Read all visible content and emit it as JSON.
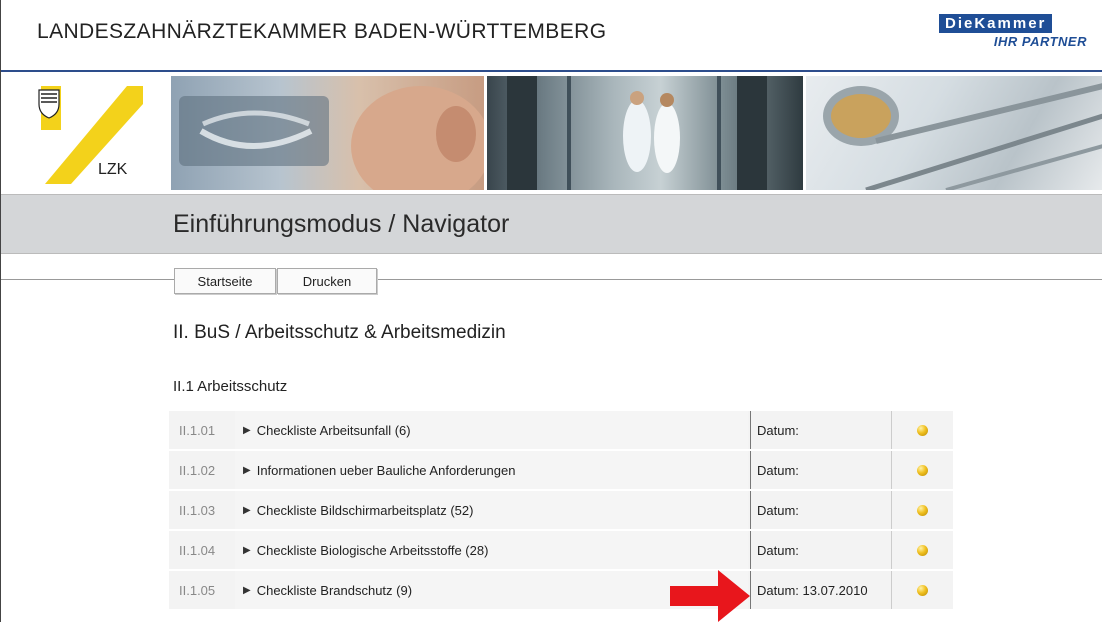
{
  "header": {
    "org_name": "LANDESZAHNÄRZTEKAMMER BADEN-WÜRTTEMBERG",
    "brand_top": "DieKammer",
    "brand_sub": "IHR PARTNER",
    "logo_text": "LZK"
  },
  "page": {
    "title": "Einführungsmodus / Navigator"
  },
  "nav": {
    "start_label": "Startseite",
    "print_label": "Drucken"
  },
  "content": {
    "section_heading": "II. BuS / Arbeitsschutz & Arbeitsmedizin",
    "sub_heading": "II.1 Arbeitsschutz",
    "rows": [
      {
        "code": "II.1.01",
        "title": "Checkliste Arbeitsunfall (6)",
        "date": "Datum:"
      },
      {
        "code": "II.1.02",
        "title": "Informationen ueber Bauliche Anforderungen",
        "date": "Datum:"
      },
      {
        "code": "II.1.03",
        "title": "Checkliste Bildschirmarbeitsplatz (52)",
        "date": "Datum:"
      },
      {
        "code": "II.1.04",
        "title": "Checkliste Biologische Arbeitsstoffe (28)",
        "date": "Datum:"
      },
      {
        "code": "II.1.05",
        "title": "Checkliste Brandschutz (9)",
        "date": "Datum: 13.07.2010"
      }
    ]
  },
  "colors": {
    "accent_blue": "#1f4e96",
    "logo_yellow": "#f3d21b",
    "status_dot": "#f0c020",
    "arrow_red": "#e8161c"
  },
  "icons": {
    "expand": "triangle-right-icon",
    "status": "yellow-dot-icon",
    "annotation": "red-arrow-icon"
  }
}
